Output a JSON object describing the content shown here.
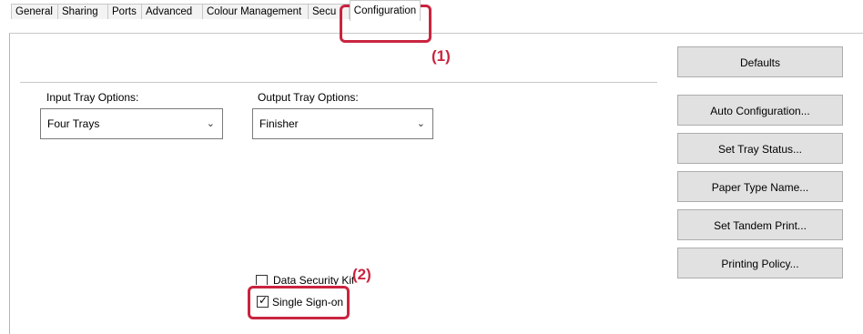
{
  "tabs": [
    {
      "label": "General"
    },
    {
      "label": "Sharing"
    },
    {
      "label": "Ports"
    },
    {
      "label": "Advanced"
    },
    {
      "label": "Colour Management"
    },
    {
      "label": "Secu"
    },
    {
      "label": "Configuration",
      "active": true
    }
  ],
  "callouts": {
    "one": "(1)",
    "two": "(2)"
  },
  "input_tray": {
    "label": "Input Tray Options:",
    "value": "Four Trays"
  },
  "output_tray": {
    "label": "Output Tray Options:",
    "value": "Finisher"
  },
  "buttons": {
    "defaults": "Defaults",
    "auto_config": "Auto Configuration...",
    "tray_status": "Set Tray Status...",
    "paper_type": "Paper Type Name...",
    "tandem": "Set Tandem Print...",
    "policy": "Printing Policy..."
  },
  "checkboxes": {
    "data_security": {
      "label": "Data Security Kit",
      "checked": false
    },
    "sso": {
      "label": "Single Sign-on",
      "checked": true
    }
  },
  "colors": {
    "highlight": "#c9243f",
    "button_bg": "#e1e1e1"
  }
}
